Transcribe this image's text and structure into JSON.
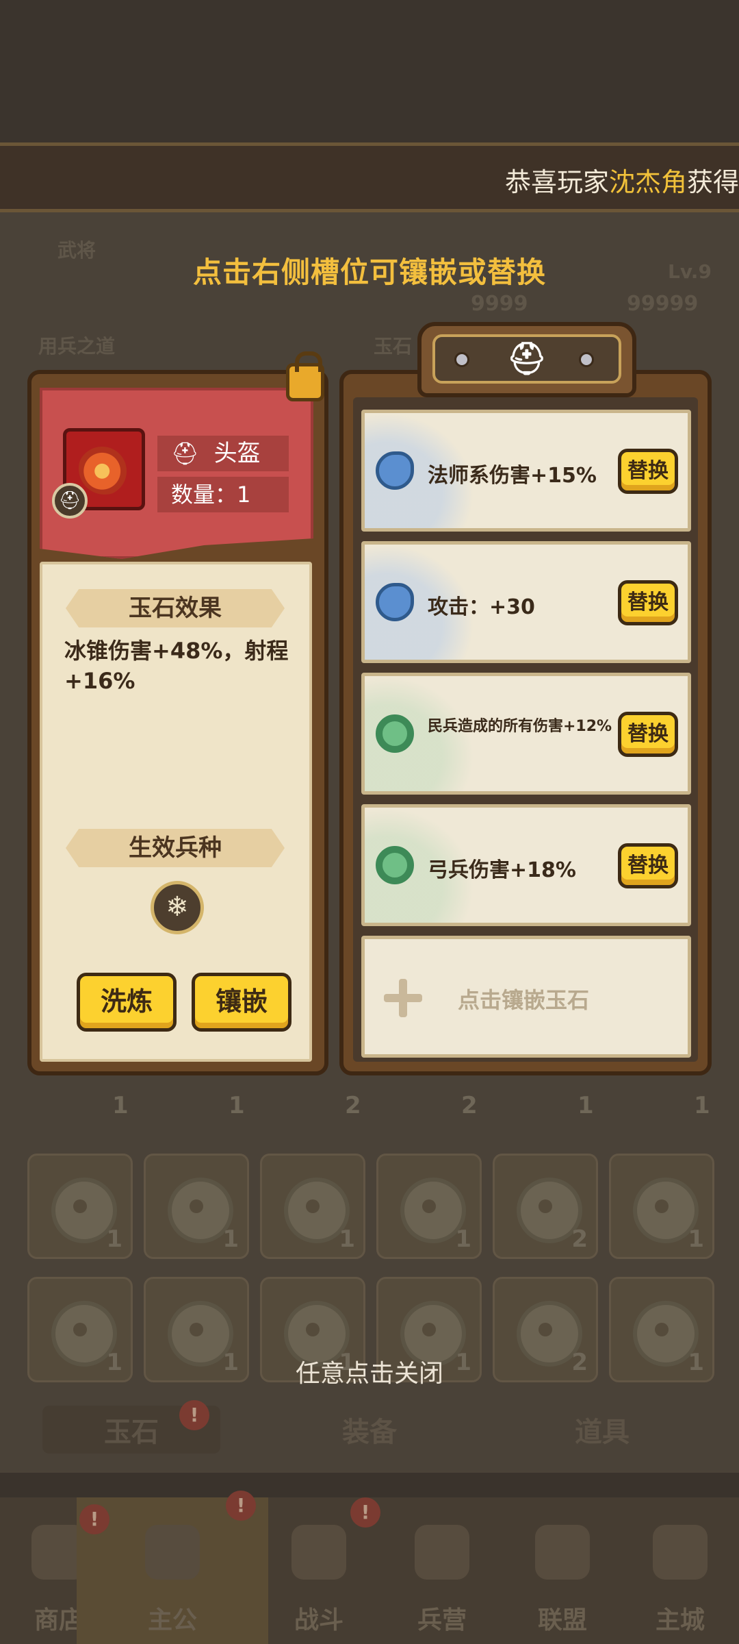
{
  "marquee": {
    "prefix": "恭喜玩家",
    "player": "沈杰角",
    "suffix": "获得"
  },
  "hint": "点击右侧槽位可镶嵌或替换",
  "background": {
    "side_labels": [
      "武将",
      "用兵之道",
      "玉石"
    ],
    "hero_levels": [
      "Lv.9"
    ],
    "hero_counts": [
      "9999",
      "99999"
    ],
    "row1_counts": [
      "1",
      "1",
      "2",
      "2",
      "1",
      "1"
    ],
    "row2_counts": [
      "1",
      "1",
      "1",
      "1",
      "2",
      "1"
    ],
    "row3_counts": [
      "1",
      "1",
      "1",
      "1",
      "2",
      "1"
    ]
  },
  "item": {
    "slot_name": "头盔",
    "quantity_label": "数量：1",
    "effect_header": "玉石效果",
    "effect_text": "冰锥伤害+48%，射程+16%",
    "troop_header": "生效兵种",
    "troop_icon": "snowflake-icon",
    "refine_button": "洗炼",
    "inlay_button": "镶嵌"
  },
  "slots": [
    {
      "text": "法师系伤害+15%",
      "jade_color": "#5b8fd0",
      "wash_color": "#b9cde8",
      "button": "替换"
    },
    {
      "text": "攻击：+30",
      "jade_color": "#5b8fd0",
      "wash_color": "#b9cde8",
      "button": "替换"
    },
    {
      "text": "民兵造成的所有伤害+12%",
      "jade_color": "#6fbf86",
      "wash_color": "#c5dcbf",
      "button": "替换"
    },
    {
      "text": "弓兵伤害+18%",
      "jade_color": "#6fbf86",
      "wash_color": "#c5dcbf",
      "button": "替换"
    }
  ],
  "empty_slot": {
    "text": "点击镶嵌玉石"
  },
  "close_tip": "任意点击关闭",
  "subtabs": [
    "玉石",
    "装备",
    "道具"
  ],
  "nav": [
    "商店",
    "主公",
    "战斗",
    "兵营",
    "联盟",
    "主城"
  ],
  "colors": {
    "accent_yellow": "#fcd12f",
    "hint_gold": "#f3bf3e",
    "banner_red": "#c8504f"
  }
}
